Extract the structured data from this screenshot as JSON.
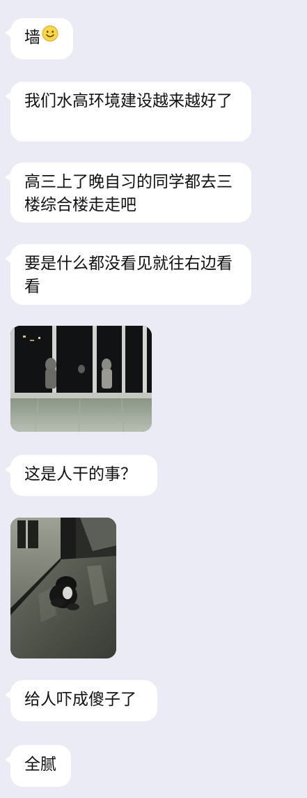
{
  "messages": [
    {
      "type": "text",
      "text": "墙",
      "emoji": "smile-emoji"
    },
    {
      "type": "text",
      "text": "我们水高环境建设越来越好了"
    },
    {
      "type": "text",
      "text": "高三上了晚自习的同学都去三楼综合楼走走吧"
    },
    {
      "type": "text",
      "text": "要是什么都没看见就往右边看看"
    },
    {
      "type": "image",
      "content": "photo-window-night"
    },
    {
      "type": "text",
      "text": "这是人干的事？"
    },
    {
      "type": "image",
      "content": "photo-corridor-crouching-figure"
    },
    {
      "type": "text",
      "text": "给人吓成傻子了"
    },
    {
      "type": "text",
      "text": "全腻"
    }
  ],
  "colors": {
    "background": "#ebebf5",
    "bubble": "#ffffff",
    "text": "#111111"
  }
}
